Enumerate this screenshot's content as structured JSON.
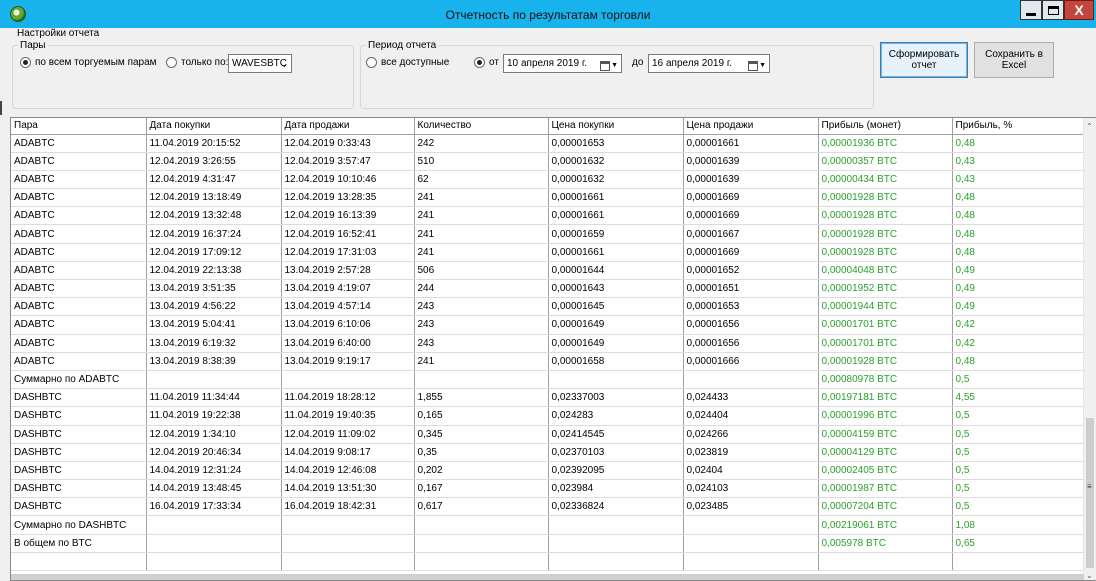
{
  "window": {
    "title": "Отчетность по результатам торговли",
    "close_label": "X"
  },
  "settings": {
    "label": "Настройки отчета",
    "pairs": {
      "title": "Пары",
      "all_label": "по всем торгуемым парам",
      "only_label": "только по:",
      "selected_pair": "WAVESBTC",
      "selection": "all"
    },
    "period": {
      "title": "Период отчета",
      "all_label": "все доступные",
      "from_label": "от",
      "to_label": "до",
      "selection": "from",
      "from_date": {
        "day": "10",
        "rest": "апреля  2019 г."
      },
      "to_date": {
        "day": "16",
        "rest": "апреля  2019 г."
      }
    },
    "buttons": {
      "generate_line1": "Сформировать",
      "generate_line2": "отчет",
      "excel_line1": "Сохранить в",
      "excel_line2": "Excel"
    }
  },
  "table": {
    "columns": [
      "Пара",
      "Дата покупки",
      "Дата продажи",
      "Количество",
      "Цена покупки",
      "Цена продажи",
      "Прибыль (монет)",
      "Прибыль, %"
    ],
    "rows": [
      [
        "ADABTC",
        "11.04.2019 20:15:52",
        "12.04.2019 0:33:43",
        "242",
        "0,00001653",
        "0,00001661",
        "0,00001936 BTC",
        "0,48"
      ],
      [
        "ADABTC",
        "12.04.2019 3:26:55",
        "12.04.2019 3:57:47",
        "510",
        "0,00001632",
        "0,00001639",
        "0,00000357 BTC",
        "0,43"
      ],
      [
        "ADABTC",
        "12.04.2019 4:31:47",
        "12.04.2019 10:10:46",
        "62",
        "0,00001632",
        "0,00001639",
        "0,00000434 BTC",
        "0,43"
      ],
      [
        "ADABTC",
        "12.04.2019 13:18:49",
        "12.04.2019 13:28:35",
        "241",
        "0,00001661",
        "0,00001669",
        "0,00001928 BTC",
        "0,48"
      ],
      [
        "ADABTC",
        "12.04.2019 13:32:48",
        "12.04.2019 16:13:39",
        "241",
        "0,00001661",
        "0,00001669",
        "0,00001928 BTC",
        "0,48"
      ],
      [
        "ADABTC",
        "12.04.2019 16:37:24",
        "12.04.2019 16:52:41",
        "241",
        "0,00001659",
        "0,00001667",
        "0,00001928 BTC",
        "0,48"
      ],
      [
        "ADABTC",
        "12.04.2019 17:09:12",
        "12.04.2019 17:31:03",
        "241",
        "0,00001661",
        "0,00001669",
        "0,00001928 BTC",
        "0,48"
      ],
      [
        "ADABTC",
        "12.04.2019 22:13:38",
        "13.04.2019 2:57:28",
        "506",
        "0,00001644",
        "0,00001652",
        "0,00004048 BTC",
        "0,49"
      ],
      [
        "ADABTC",
        "13.04.2019 3:51:35",
        "13.04.2019 4:19:07",
        "244",
        "0,00001643",
        "0,00001651",
        "0,00001952 BTC",
        "0,49"
      ],
      [
        "ADABTC",
        "13.04.2019 4:56:22",
        "13.04.2019 4:57:14",
        "243",
        "0,00001645",
        "0,00001653",
        "0,00001944 BTC",
        "0,49"
      ],
      [
        "ADABTC",
        "13.04.2019 5:04:41",
        "13.04.2019 6:10:06",
        "243",
        "0,00001649",
        "0,00001656",
        "0,00001701 BTC",
        "0,42"
      ],
      [
        "ADABTC",
        "13.04.2019 6:19:32",
        "13.04.2019 6:40:00",
        "243",
        "0,00001649",
        "0,00001656",
        "0,00001701 BTC",
        "0,42"
      ],
      [
        "ADABTC",
        "13.04.2019 8:38:39",
        "13.04.2019 9:19:17",
        "241",
        "0,00001658",
        "0,00001666",
        "0,00001928 BTC",
        "0,48"
      ],
      [
        "Суммарно по ADABTC",
        "",
        "",
        "",
        "",
        "",
        "0,00080978 BTC",
        "0,5"
      ],
      [
        "DASHBTC",
        "11.04.2019 11:34:44",
        "11.04.2019 18:28:12",
        "1,855",
        "0,02337003",
        "0,024433",
        "0,00197181 BTC",
        "4,55"
      ],
      [
        "DASHBTC",
        "11.04.2019 19:22:38",
        "11.04.2019 19:40:35",
        "0,165",
        "0,024283",
        "0,024404",
        "0,00001996 BTC",
        "0,5"
      ],
      [
        "DASHBTC",
        "12.04.2019 1:34:10",
        "12.04.2019 11:09:02",
        "0,345",
        "0,02414545",
        "0,024266",
        "0,00004159 BTC",
        "0,5"
      ],
      [
        "DASHBTC",
        "12.04.2019 20:46:34",
        "14.04.2019 9:08:17",
        "0,35",
        "0,02370103",
        "0,023819",
        "0,00004129 BTC",
        "0,5"
      ],
      [
        "DASHBTC",
        "14.04.2019 12:31:24",
        "14.04.2019 12:46:08",
        "0,202",
        "0,02392095",
        "0,02404",
        "0,00002405 BTC",
        "0,5"
      ],
      [
        "DASHBTC",
        "14.04.2019 13:48:45",
        "14.04.2019 13:51:30",
        "0,167",
        "0,023984",
        "0,024103",
        "0,00001987 BTC",
        "0,5"
      ],
      [
        "DASHBTC",
        "16.04.2019 17:33:34",
        "16.04.2019 18:42:31",
        "0,617",
        "0,02336824",
        "0,023485",
        "0,00007204 BTC",
        "0,5"
      ],
      [
        "Суммарно по DASHBTC",
        "",
        "",
        "",
        "",
        "",
        "0,00219061 BTC",
        "1,08"
      ],
      [
        "В общем по BTC",
        "",
        "",
        "",
        "",
        "",
        "0,005978 BTC",
        "0,65"
      ],
      [
        "",
        "",
        "",
        "",
        "",
        "",
        "",
        ""
      ]
    ]
  },
  "colors": {
    "titlebar": "#18b2ec",
    "profit_text": "#2ca02c",
    "close_button": "#c2463e"
  }
}
